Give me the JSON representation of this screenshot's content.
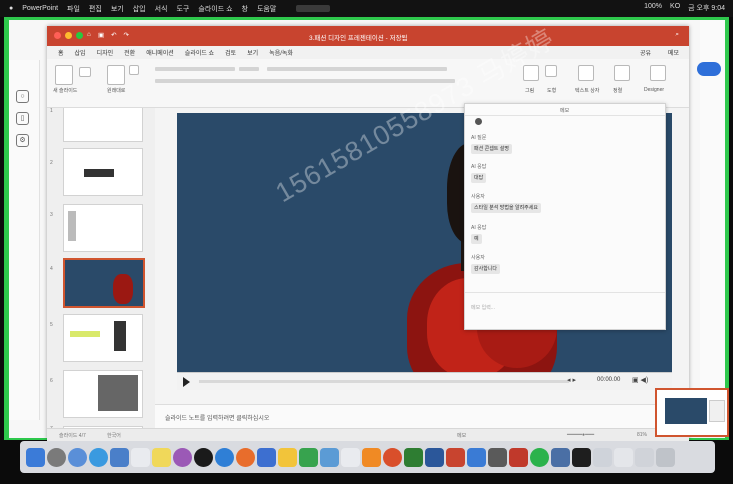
{
  "menubar": {
    "app": "PowerPoint",
    "items": [
      "파일",
      "편집",
      "보기",
      "삽입",
      "서식",
      "도구",
      "슬라이드 쇼",
      "창",
      "도움말"
    ],
    "center_pill": "",
    "right": [
      "100%",
      "KO",
      "금 오후 9:04"
    ]
  },
  "window": {
    "title": "3.패션 디자인 프레젠테이션 - 저장됨",
    "tabs": [
      "홈",
      "삽입",
      "디자인",
      "전환",
      "애니메이션",
      "슬라이드 쇼",
      "검토",
      "보기",
      "녹음/녹화"
    ],
    "share": "공유",
    "comment": "메모"
  },
  "ribbon": {
    "new_slide": "새 슬라이드",
    "layout": "레이아웃",
    "reset": "원래대로",
    "picture": "그림",
    "shapes": "도형",
    "textbox": "텍스트 상자",
    "arrange": "정렬",
    "quick_styles": "빠른 스타일",
    "designer": "Designer",
    "addins": "추가 기능"
  },
  "thumbs": {
    "numbers": [
      "1",
      "2",
      "3",
      "4",
      "5",
      "6",
      "7"
    ]
  },
  "slide": {
    "watermark": "15615810558973 马婷婷",
    "time": "00:00.00"
  },
  "notes": {
    "text": "슬라이드 노트를 입력하려면 클릭하십시오"
  },
  "status": {
    "left": "슬라이드 4/7",
    "lang": "한국어",
    "right": "메모",
    "zoom": "81%"
  },
  "panel": {
    "title": "메모",
    "rows": [
      {
        "label": "AI 질문",
        "chip": "패션 콘셉트 설명"
      },
      {
        "label": "AI 응답",
        "chip": "대답"
      },
      {
        "label": "사용자",
        "chip": "스타일 분석 방법을 알려주세요"
      },
      {
        "label": "AI 응답",
        "chip": "예"
      },
      {
        "label": "사용자",
        "chip": "감사합니다"
      }
    ],
    "input_placeholder": "메모 입력..."
  },
  "colors": {
    "title_red": "#c8442f",
    "frame_green": "#2ec84c",
    "slide_blue": "#2a4a69",
    "accent_orange": "#d0552f"
  }
}
